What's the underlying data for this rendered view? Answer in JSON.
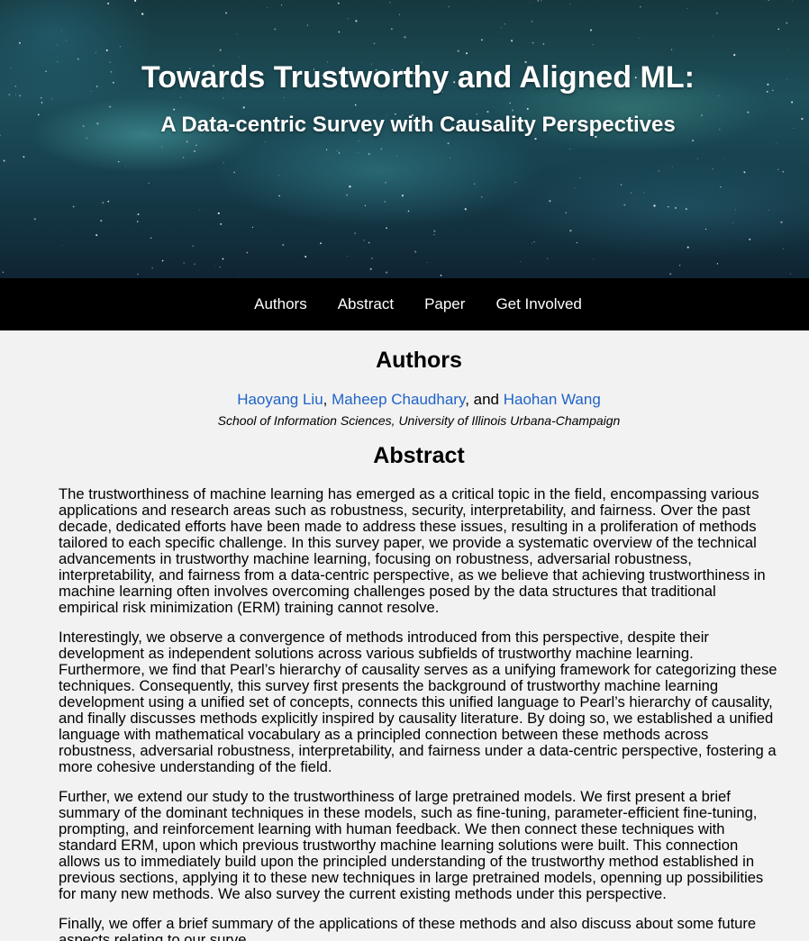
{
  "hero": {
    "title": "Towards Trustworthy and Aligned ML:",
    "subtitle": "A Data-centric Survey with Causality Perspectives"
  },
  "nav": {
    "items": [
      "Authors",
      "Abstract",
      "Paper",
      "Get Involved"
    ]
  },
  "authors": {
    "heading": "Authors",
    "names": [
      "Haoyang Liu",
      "Maheep Chaudhary",
      "Haohan Wang"
    ],
    "sep1": ", ",
    "sep2": ", and ",
    "affiliation": "School of Information Sciences, University of Illinois Urbana-Champaign"
  },
  "abstract": {
    "heading": "Abstract",
    "paragraphs": [
      "The trustworthiness of machine learning has emerged as a critical topic in the field, encompassing various applications and research areas such as robustness, security, interpretability, and fairness. Over the past decade, dedicated efforts have been made to address these issues, resulting in a proliferation of methods tailored to each specific challenge. In this survey paper, we provide a systematic overview of the technical advancements in trustworthy machine learning, focusing on robustness, adversarial robustness, interpretability, and fairness from a data-centric perspective, as we believe that achieving trustworthiness in machine learning often involves overcoming challenges posed by the data structures that traditional empirical risk minimization (ERM) training cannot resolve.",
      "Interestingly, we observe a convergence of methods introduced from this perspective, despite their development as independent solutions across various subfields of trustworthy machine learning. Furthermore, we find that Pearl’s hierarchy of causality serves as a unifying framework for categorizing these techniques. Consequently, this survey first presents the background of trustworthy machine learning development using a unified set of concepts, connects this unified language to Pearl’s hierarchy of causality, and finally discusses methods explicitly inspired by causality literature. By doing so, we established a unified language with mathematical vocabulary as a principled connection between these methods across robustness, adversarial robustness, interpretability, and fairness under a data-centric perspective, fostering a more cohesive understanding of the field.",
      "Further, we extend our study to the trustworthiness of large pretrained models. We first present a brief summary of the dominant techniques in these models, such as fine-tuning, parameter-efficient fine-tuning, prompting, and reinforcement learning with human feedback. We then connect these techniques with standard ERM, upon which previous trustworthy machine learning solutions were built. This connection allows us to immediately build upon the principled understanding of the trustworthy method established in previous sections, applying it to these new techniques in large pretrained models, openning up possibilities for many new methods. We also survey the current existing methods under this perspective.",
      "Finally, we offer a brief summary of the applications of these methods and also discuss about some future aspects relating to our surve"
    ]
  }
}
